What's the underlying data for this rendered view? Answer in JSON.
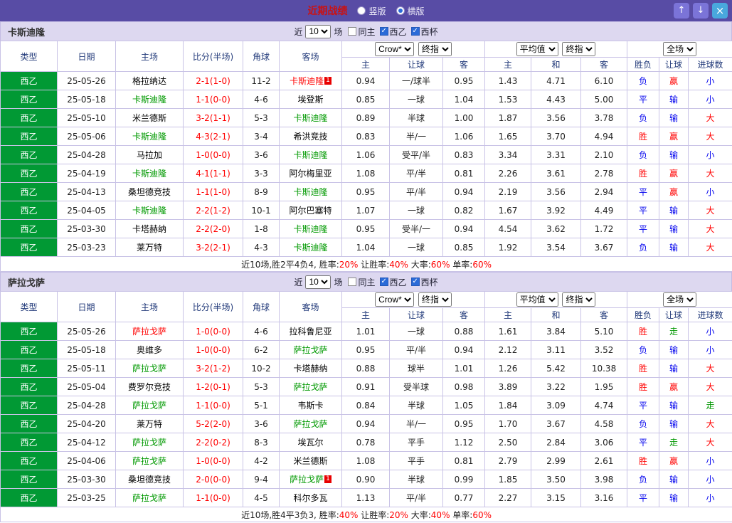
{
  "titlebar": {
    "title": "近期战绩",
    "radios": [
      {
        "label": "竖版",
        "checked": false
      },
      {
        "label": "横版",
        "checked": true
      }
    ],
    "up_icon": "↑",
    "down_icon": "↓",
    "close_icon": "×"
  },
  "filters": {
    "near_label": "近",
    "count_value": "10",
    "matches_label": "场",
    "checkboxes": [
      {
        "label": "同主",
        "checked": false
      },
      {
        "label": "西乙",
        "checked": true
      },
      {
        "label": "西杯",
        "checked": true
      }
    ]
  },
  "table_header": {
    "type": "类型",
    "date": "日期",
    "home": "主场",
    "score": "比分(半场)",
    "corner": "角球",
    "away": "客场",
    "odds_group1": {
      "select1": "Crow*",
      "select2": "终指",
      "cols": [
        "主",
        "让球",
        "客"
      ]
    },
    "odds_group2": {
      "select1": "平均值",
      "select2": "终指",
      "cols": [
        "主",
        "和",
        "客"
      ]
    },
    "result_group": {
      "select1": "全场",
      "cols": [
        "胜负",
        "让球",
        "进球数"
      ]
    }
  },
  "result_colors": {
    "胜": "#FF0000",
    "平": "#0000EE",
    "负": "#0000EE",
    "赢": "#FF0000",
    "输": "#0000EE",
    "走": "#009900",
    "大": "#FF0000",
    "小": "#0000EE"
  },
  "team_colors": {
    "opp": "#000000",
    "self": "#009900",
    "self-red": "#FF0000"
  },
  "league_badge_color": "#019934",
  "tables": [
    {
      "team": "卡斯迪隆",
      "rows": [
        {
          "league": "西乙",
          "date": "25-05-26",
          "home": "格拉纳达",
          "home_color": "opp",
          "home_redcard": "",
          "score": "2-1(1-0)",
          "corners": "11-2",
          "away": "卡斯迪隆",
          "away_color": "self-red",
          "away_redcard": "1",
          "crow_home": "0.94",
          "handicap": "一/球半",
          "crow_away": "0.95",
          "avg_home": "1.43",
          "avg_draw": "4.71",
          "avg_away": "6.10",
          "result": "负",
          "handicap_result": "赢",
          "goals_result": "小"
        },
        {
          "league": "西乙",
          "date": "25-05-18",
          "home": "卡斯迪隆",
          "home_color": "self",
          "home_redcard": "",
          "score": "1-1(0-0)",
          "corners": "4-6",
          "away": "埃登斯",
          "away_color": "opp",
          "away_redcard": "",
          "crow_home": "0.85",
          "handicap": "一球",
          "crow_away": "1.04",
          "avg_home": "1.53",
          "avg_draw": "4.43",
          "avg_away": "5.00",
          "result": "平",
          "handicap_result": "输",
          "goals_result": "小"
        },
        {
          "league": "西乙",
          "date": "25-05-10",
          "home": "米兰德斯",
          "home_color": "opp",
          "home_redcard": "",
          "score": "3-2(1-1)",
          "corners": "5-3",
          "away": "卡斯迪隆",
          "away_color": "self",
          "away_redcard": "",
          "crow_home": "0.89",
          "handicap": "半球",
          "crow_away": "1.00",
          "avg_home": "1.87",
          "avg_draw": "3.56",
          "avg_away": "3.78",
          "result": "负",
          "handicap_result": "输",
          "goals_result": "大"
        },
        {
          "league": "西乙",
          "date": "25-05-06",
          "home": "卡斯迪隆",
          "home_color": "self",
          "home_redcard": "",
          "score": "4-3(2-1)",
          "corners": "3-4",
          "away": "希洪竞技",
          "away_color": "opp",
          "away_redcard": "",
          "crow_home": "0.83",
          "handicap": "半/一",
          "crow_away": "1.06",
          "avg_home": "1.65",
          "avg_draw": "3.70",
          "avg_away": "4.94",
          "result": "胜",
          "handicap_result": "赢",
          "goals_result": "大"
        },
        {
          "league": "西乙",
          "date": "25-04-28",
          "home": "马拉加",
          "home_color": "opp",
          "home_redcard": "",
          "score": "1-0(0-0)",
          "corners": "3-6",
          "away": "卡斯迪隆",
          "away_color": "self",
          "away_redcard": "",
          "crow_home": "1.06",
          "handicap": "受平/半",
          "crow_away": "0.83",
          "avg_home": "3.34",
          "avg_draw": "3.31",
          "avg_away": "2.10",
          "result": "负",
          "handicap_result": "输",
          "goals_result": "小"
        },
        {
          "league": "西乙",
          "date": "25-04-19",
          "home": "卡斯迪隆",
          "home_color": "self",
          "home_redcard": "",
          "score": "4-1(1-1)",
          "corners": "3-3",
          "away": "阿尔梅里亚",
          "away_color": "opp",
          "away_redcard": "",
          "crow_home": "1.08",
          "handicap": "平/半",
          "crow_away": "0.81",
          "avg_home": "2.26",
          "avg_draw": "3.61",
          "avg_away": "2.78",
          "result": "胜",
          "handicap_result": "赢",
          "goals_result": "大"
        },
        {
          "league": "西乙",
          "date": "25-04-13",
          "home": "桑坦德竞技",
          "home_color": "opp",
          "home_redcard": "",
          "score": "1-1(1-0)",
          "corners": "8-9",
          "away": "卡斯迪隆",
          "away_color": "self",
          "away_redcard": "",
          "crow_home": "0.95",
          "handicap": "平/半",
          "crow_away": "0.94",
          "avg_home": "2.19",
          "avg_draw": "3.56",
          "avg_away": "2.94",
          "result": "平",
          "handicap_result": "赢",
          "goals_result": "小"
        },
        {
          "league": "西乙",
          "date": "25-04-05",
          "home": "卡斯迪隆",
          "home_color": "self",
          "home_redcard": "",
          "score": "2-2(1-2)",
          "corners": "10-1",
          "away": "阿尔巴塞特",
          "away_color": "opp",
          "away_redcard": "",
          "crow_home": "1.07",
          "handicap": "一球",
          "crow_away": "0.82",
          "avg_home": "1.67",
          "avg_draw": "3.92",
          "avg_away": "4.49",
          "result": "平",
          "handicap_result": "输",
          "goals_result": "大"
        },
        {
          "league": "西乙",
          "date": "25-03-30",
          "home": "卡塔赫纳",
          "home_color": "opp",
          "home_redcard": "",
          "score": "2-2(2-0)",
          "corners": "1-8",
          "away": "卡斯迪隆",
          "away_color": "self",
          "away_redcard": "",
          "crow_home": "0.95",
          "handicap": "受半/一",
          "crow_away": "0.94",
          "avg_home": "4.54",
          "avg_draw": "3.62",
          "avg_away": "1.72",
          "result": "平",
          "handicap_result": "输",
          "goals_result": "大"
        },
        {
          "league": "西乙",
          "date": "25-03-23",
          "home": "莱万特",
          "home_color": "opp",
          "home_redcard": "",
          "score": "3-2(2-1)",
          "corners": "4-3",
          "away": "卡斯迪隆",
          "away_color": "self",
          "away_redcard": "",
          "crow_home": "1.04",
          "handicap": "一球",
          "crow_away": "0.85",
          "avg_home": "1.92",
          "avg_draw": "3.54",
          "avg_away": "3.67",
          "result": "负",
          "handicap_result": "输",
          "goals_result": "大"
        }
      ],
      "summary": {
        "prefix": "近10场,胜2平4负4,",
        "stats": [
          {
            "label": "胜率:",
            "value": "20%"
          },
          {
            "label": "让胜率:",
            "value": "40%"
          },
          {
            "label": "大率:",
            "value": "60%"
          },
          {
            "label": "单率:",
            "value": "60%"
          }
        ]
      }
    },
    {
      "team": "萨拉戈萨",
      "rows": [
        {
          "league": "西乙",
          "date": "25-05-26",
          "home": "萨拉戈萨",
          "home_color": "self-red",
          "home_redcard": "",
          "score": "1-0(0-0)",
          "corners": "4-6",
          "away": "拉科鲁尼亚",
          "away_color": "opp",
          "away_redcard": "",
          "crow_home": "1.01",
          "handicap": "一球",
          "crow_away": "0.88",
          "avg_home": "1.61",
          "avg_draw": "3.84",
          "avg_away": "5.10",
          "result": "胜",
          "handicap_result": "走",
          "goals_result": "小"
        },
        {
          "league": "西乙",
          "date": "25-05-18",
          "home": "奥维多",
          "home_color": "opp",
          "home_redcard": "",
          "score": "1-0(0-0)",
          "corners": "6-2",
          "away": "萨拉戈萨",
          "away_color": "self",
          "away_redcard": "",
          "crow_home": "0.95",
          "handicap": "平/半",
          "crow_away": "0.94",
          "avg_home": "2.12",
          "avg_draw": "3.11",
          "avg_away": "3.52",
          "result": "负",
          "handicap_result": "输",
          "goals_result": "小"
        },
        {
          "league": "西乙",
          "date": "25-05-11",
          "home": "萨拉戈萨",
          "home_color": "self",
          "home_redcard": "",
          "score": "3-2(1-2)",
          "corners": "10-2",
          "away": "卡塔赫纳",
          "away_color": "opp",
          "away_redcard": "",
          "crow_home": "0.88",
          "handicap": "球半",
          "crow_away": "1.01",
          "avg_home": "1.26",
          "avg_draw": "5.42",
          "avg_away": "10.38",
          "result": "胜",
          "handicap_result": "输",
          "goals_result": "大"
        },
        {
          "league": "西乙",
          "date": "25-05-04",
          "home": "费罗尔竞技",
          "home_color": "opp",
          "home_redcard": "",
          "score": "1-2(0-1)",
          "corners": "5-3",
          "away": "萨拉戈萨",
          "away_color": "self",
          "away_redcard": "",
          "crow_home": "0.91",
          "handicap": "受半球",
          "crow_away": "0.98",
          "avg_home": "3.89",
          "avg_draw": "3.22",
          "avg_away": "1.95",
          "result": "胜",
          "handicap_result": "赢",
          "goals_result": "大"
        },
        {
          "league": "西乙",
          "date": "25-04-28",
          "home": "萨拉戈萨",
          "home_color": "self",
          "home_redcard": "",
          "score": "1-1(0-0)",
          "corners": "5-1",
          "away": "韦斯卡",
          "away_color": "opp",
          "away_redcard": "",
          "crow_home": "0.84",
          "handicap": "半球",
          "crow_away": "1.05",
          "avg_home": "1.84",
          "avg_draw": "3.09",
          "avg_away": "4.74",
          "result": "平",
          "handicap_result": "输",
          "goals_result": "走"
        },
        {
          "league": "西乙",
          "date": "25-04-20",
          "home": "莱万特",
          "home_color": "opp",
          "home_redcard": "",
          "score": "5-2(2-0)",
          "corners": "3-6",
          "away": "萨拉戈萨",
          "away_color": "self",
          "away_redcard": "",
          "crow_home": "0.94",
          "handicap": "半/一",
          "crow_away": "0.95",
          "avg_home": "1.70",
          "avg_draw": "3.67",
          "avg_away": "4.58",
          "result": "负",
          "handicap_result": "输",
          "goals_result": "大"
        },
        {
          "league": "西乙",
          "date": "25-04-12",
          "home": "萨拉戈萨",
          "home_color": "self",
          "home_redcard": "",
          "score": "2-2(0-2)",
          "corners": "8-3",
          "away": "埃瓦尔",
          "away_color": "opp",
          "away_redcard": "",
          "crow_home": "0.78",
          "handicap": "平手",
          "crow_away": "1.12",
          "avg_home": "2.50",
          "avg_draw": "2.84",
          "avg_away": "3.06",
          "result": "平",
          "handicap_result": "走",
          "goals_result": "大"
        },
        {
          "league": "西乙",
          "date": "25-04-06",
          "home": "萨拉戈萨",
          "home_color": "self",
          "home_redcard": "",
          "score": "1-0(0-0)",
          "corners": "4-2",
          "away": "米兰德斯",
          "away_color": "opp",
          "away_redcard": "",
          "crow_home": "1.08",
          "handicap": "平手",
          "crow_away": "0.81",
          "avg_home": "2.79",
          "avg_draw": "2.99",
          "avg_away": "2.61",
          "result": "胜",
          "handicap_result": "赢",
          "goals_result": "小"
        },
        {
          "league": "西乙",
          "date": "25-03-30",
          "home": "桑坦德竞技",
          "home_color": "opp",
          "home_redcard": "",
          "score": "2-0(0-0)",
          "corners": "9-4",
          "away": "萨拉戈萨",
          "away_color": "self",
          "away_redcard": "1",
          "crow_home": "0.90",
          "handicap": "半球",
          "crow_away": "0.99",
          "avg_home": "1.85",
          "avg_draw": "3.50",
          "avg_away": "3.98",
          "result": "负",
          "handicap_result": "输",
          "goals_result": "小"
        },
        {
          "league": "西乙",
          "date": "25-03-25",
          "home": "萨拉戈萨",
          "home_color": "self",
          "home_redcard": "",
          "score": "1-1(0-0)",
          "corners": "4-5",
          "away": "科尔多瓦",
          "away_color": "opp",
          "away_redcard": "",
          "crow_home": "1.13",
          "handicap": "平/半",
          "crow_away": "0.77",
          "avg_home": "2.27",
          "avg_draw": "3.15",
          "avg_away": "3.16",
          "result": "平",
          "handicap_result": "输",
          "goals_result": "小"
        }
      ],
      "summary": {
        "prefix": "近10场,胜4平3负3,",
        "stats": [
          {
            "label": "胜率:",
            "value": "40%"
          },
          {
            "label": "让胜率:",
            "value": "20%"
          },
          {
            "label": "大率:",
            "value": "40%"
          },
          {
            "label": "单率:",
            "value": "60%"
          }
        ]
      }
    }
  ]
}
